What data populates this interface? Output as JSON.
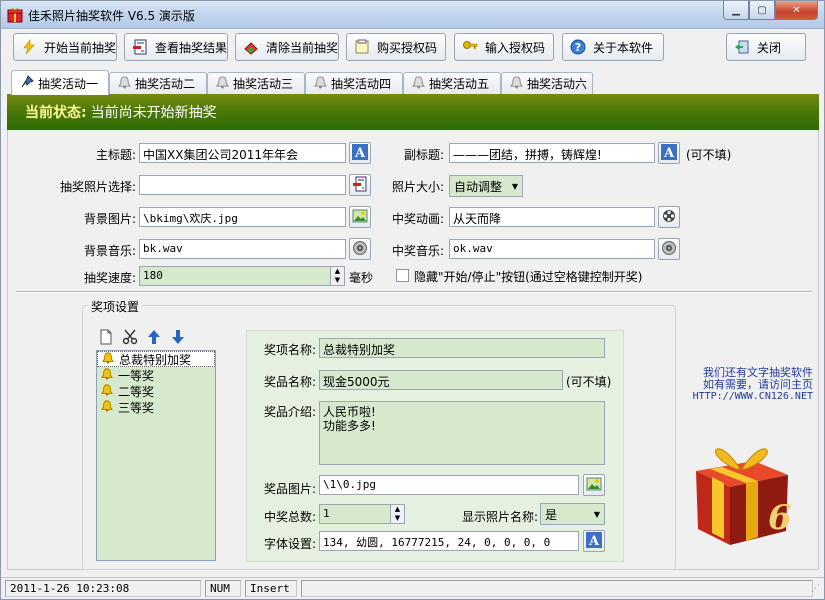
{
  "window": {
    "title": "佳禾照片抽奖软件 V6.5 演示版"
  },
  "toolbar": {
    "start": "开始当前抽奖",
    "view_results": "查看抽奖结果",
    "clear": "清除当前抽奖",
    "buy": "购买授权码",
    "enter_code": "输入授权码",
    "about": "关于本软件",
    "close": "关闭"
  },
  "tabs": [
    "抽奖活动一",
    "抽奖活动二",
    "抽奖活动三",
    "抽奖活动四",
    "抽奖活动五",
    "抽奖活动六"
  ],
  "status": {
    "label": "当前状态:",
    "value": "当前尚未开始新抽奖"
  },
  "form": {
    "main_title_label": "主标题:",
    "main_title": "中国XX集团公司2011年年会",
    "sub_title_label": "副标题:",
    "sub_title": "———团结，拼搏，铸辉煌!",
    "optional": "(可不填)",
    "photo_select_label": "抽奖照片选择:",
    "photo_select": "",
    "photo_size_label": "照片大小:",
    "photo_size": "自动调整",
    "bg_image_label": "背景图片:",
    "bg_image": "\\bkimg\\欢庆.jpg",
    "win_anim_label": "中奖动画:",
    "win_anim": "从天而降",
    "bg_music_label": "背景音乐:",
    "bg_music": "bk.wav",
    "win_music_label": "中奖音乐:",
    "win_music": "ok.wav",
    "speed_label": "抽奖速度:",
    "speed": "180",
    "speed_unit": "毫秒",
    "hide_button_label": "隐藏\"开始/停止\"按钮(通过空格键控制开奖)"
  },
  "prize_group": {
    "title": "奖项设置",
    "items": [
      "总裁特别加奖",
      "一等奖",
      "二等奖",
      "三等奖"
    ],
    "name_label": "奖项名称:",
    "name": "总裁特别加奖",
    "prize_label": "奖品名称:",
    "prize": "现金5000元",
    "prize_optional": "(可不填)",
    "intro_label": "奖品介绍:",
    "intro_line1": "人民币啦!",
    "intro_line2": "功能多多!",
    "image_label": "奖品图片:",
    "image": "\\1\\0.jpg",
    "total_label": "中奖总数:",
    "total": "1",
    "show_name_label": "显示照片名称:",
    "show_name": "是",
    "font_label": "字体设置:",
    "font": "134, 幼圆, 16777215, 24, 0, 0, 0, 0"
  },
  "promo": {
    "line1": "我们还有文字抽奖软件",
    "line2": "如有需要，请访问主页",
    "url": "HTTP://WWW.CN126.NET"
  },
  "statusbar": {
    "datetime": "2011-1-26 10:23:08",
    "num": "NUM",
    "insert": "Insert"
  },
  "colors": {
    "status_bg": "#4f7b09",
    "status_label": "#fffa96",
    "field_green": "#d6e9cc",
    "promo_text": "#1f3a9e"
  }
}
